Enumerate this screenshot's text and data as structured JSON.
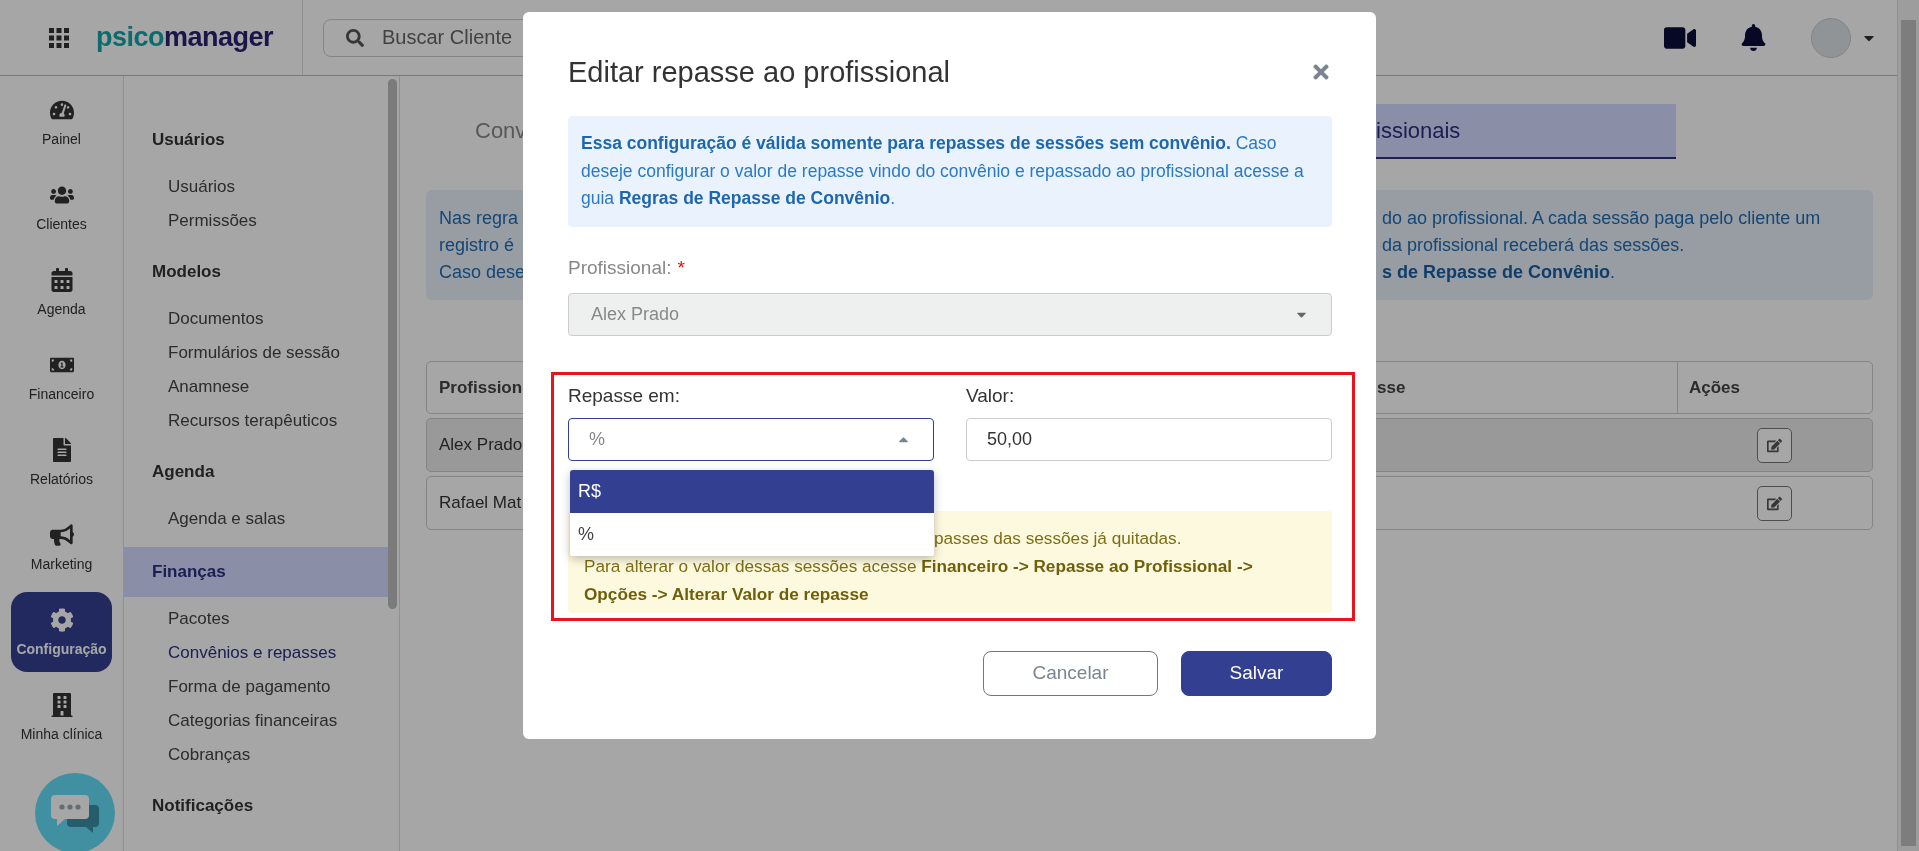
{
  "topbar": {
    "logo": {
      "part_1": "psico",
      "part_2": "manager"
    },
    "search": {
      "placeholder": "Buscar Cliente"
    }
  },
  "nav_rail": [
    {
      "label": "Painel",
      "selected": false
    },
    {
      "label": "Clientes",
      "selected": false
    },
    {
      "label": "Agenda",
      "selected": false
    },
    {
      "label": "Financeiro",
      "selected": false
    },
    {
      "label": "Relatórios",
      "selected": false
    },
    {
      "label": "Marketing",
      "selected": false
    },
    {
      "label": "Configuração",
      "selected": true
    },
    {
      "label": "Minha clínica",
      "selected": false
    }
  ],
  "submenu": [
    {
      "title": "Usuários",
      "selected": false,
      "items": [
        {
          "label": "Usuários",
          "selected": false
        },
        {
          "label": "Permissões",
          "selected": false
        }
      ]
    },
    {
      "title": "Modelos",
      "selected": false,
      "items": [
        {
          "label": "Documentos",
          "selected": false
        },
        {
          "label": "Formulários de sessão",
          "selected": false
        },
        {
          "label": "Anamnese",
          "selected": false
        },
        {
          "label": "Recursos terapêuticos",
          "selected": false
        }
      ]
    },
    {
      "title": "Agenda",
      "selected": false,
      "items": [
        {
          "label": "Agenda e salas",
          "selected": false
        }
      ]
    },
    {
      "title": "Finanças",
      "selected": true,
      "items": [
        {
          "label": "Pacotes",
          "selected": false
        },
        {
          "label": "Convênios e repasses",
          "selected": true
        },
        {
          "label": "Forma de pagamento",
          "selected": false
        },
        {
          "label": "Categorias financeiras",
          "selected": false
        },
        {
          "label": "Cobranças",
          "selected": false
        }
      ]
    },
    {
      "title": "Notificações",
      "selected": false
    }
  ],
  "background": {
    "tabs": [
      {
        "label": "Conv",
        "selected": false
      },
      {
        "label": "issionais",
        "selected": true
      }
    ],
    "info": {
      "left_lines": [
        "Nas regra",
        "registro é",
        "Caso dese"
      ],
      "right_lines": [
        "do ao profissional. A cada sessão paga pelo cliente um",
        "da profissional receberá das sessões.",
        "**s de Repasse de Convênio**."
      ]
    },
    "table": {
      "columns": [
        "Profission",
        "sse",
        "Ações"
      ],
      "rows": [
        {
          "profissional": "Alex Prado",
          "highlighted": true
        },
        {
          "profissional": "Rafael Mat",
          "highlighted": false
        }
      ]
    }
  },
  "modal": {
    "title": "Editar repasse ao profissional",
    "notice": "**Essa configuração é válida somente para repasses de sessões sem convênio.** Caso deseje configurar o valor de repasse vindo do convênio e repassado ao profissional acesse a guia **Regras de Repasse de Convênio**.",
    "professional": {
      "label": "Profissional:",
      "required_mark": "*",
      "value": "Alex Prado",
      "disabled": true
    },
    "highlight_frame": true,
    "repasse_em": {
      "label": "Repasse em:",
      "value": "%",
      "expanded": true,
      "options": [
        {
          "label": "R$",
          "highlighted": true
        },
        {
          "label": "%",
          "highlighted": false
        }
      ]
    },
    "valor": {
      "label": "Valor:",
      "value": "50,00"
    },
    "warning": {
      "line_1": "passes das sessões já quitadas.",
      "line_2": "Para alterar o valor dessas sessões acesse **Financeiro -> Repasse ao Profissional -> Opções -> Alterar Valor de repasse**"
    },
    "buttons": [
      {
        "label": "Cancelar",
        "kind": "secondary"
      },
      {
        "label": "Salvar",
        "kind": "primary"
      }
    ]
  }
}
